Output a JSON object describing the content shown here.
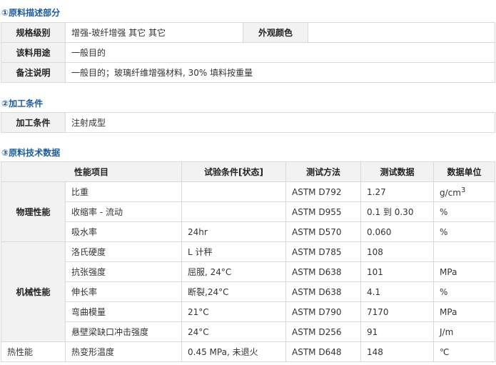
{
  "sections": {
    "s1_title": "①原料描述部分",
    "s2_title": "②加工条件",
    "s3_title": "③原料技术数据"
  },
  "desc": {
    "grade_label": "规格级别",
    "grade_value": "增强-玻纤增强 其它 其它",
    "color_label": "外观颜色",
    "color_value": "",
    "use_label": "该料用途",
    "use_value": "一般目的",
    "note_label": "备注说明",
    "note_value": "一般目的；玻璃纤维增强材料, 30% 填料按重量"
  },
  "process": {
    "label": "加工条件",
    "value": "注射成型"
  },
  "tech": {
    "headers": [
      "性能项目",
      "试验条件[状态]",
      "测试方法",
      "测试数据",
      "数据单位"
    ],
    "groups": [
      {
        "name": "物理性能",
        "rows": [
          {
            "item": "比重",
            "cond": "",
            "method": "ASTM D792",
            "value": "1.27",
            "unit": "g/cm",
            "unit_sup": "3"
          },
          {
            "item": "收缩率 - 流动",
            "cond": "",
            "method": "ASTM D955",
            "value": "0.1 到 0.30",
            "unit": "%"
          },
          {
            "item": "吸水率",
            "cond": "24hr",
            "method": "ASTM D570",
            "value": "0.060",
            "unit": "%"
          }
        ]
      },
      {
        "name": "机械性能",
        "rows": [
          {
            "item": "洛氏硬度",
            "cond": "L 计秤",
            "method": "ASTM D785",
            "value": "108",
            "unit": ""
          },
          {
            "item": "抗张强度",
            "cond": "屈服, 24°C",
            "method": "ASTM D638",
            "value": "101",
            "unit": "MPa"
          },
          {
            "item": "伸长率",
            "cond": "断裂,24°C",
            "method": "ASTM D638",
            "value": "4.1",
            "unit": "%"
          },
          {
            "item": "弯曲模量",
            "cond": "21°C",
            "method": "ASTM D790",
            "value": "7170",
            "unit": "MPa"
          },
          {
            "item": "悬壁梁缺口冲击强度",
            "cond": "24°C",
            "method": "ASTM D256",
            "value": "91",
            "unit": "J/m"
          }
        ]
      },
      {
        "name": "热性能",
        "rows": [
          {
            "item": "热变形温度",
            "cond": "0.45 MPa, 未退火",
            "method": "ASTM D648",
            "value": "148",
            "unit": "℃"
          }
        ]
      }
    ]
  }
}
